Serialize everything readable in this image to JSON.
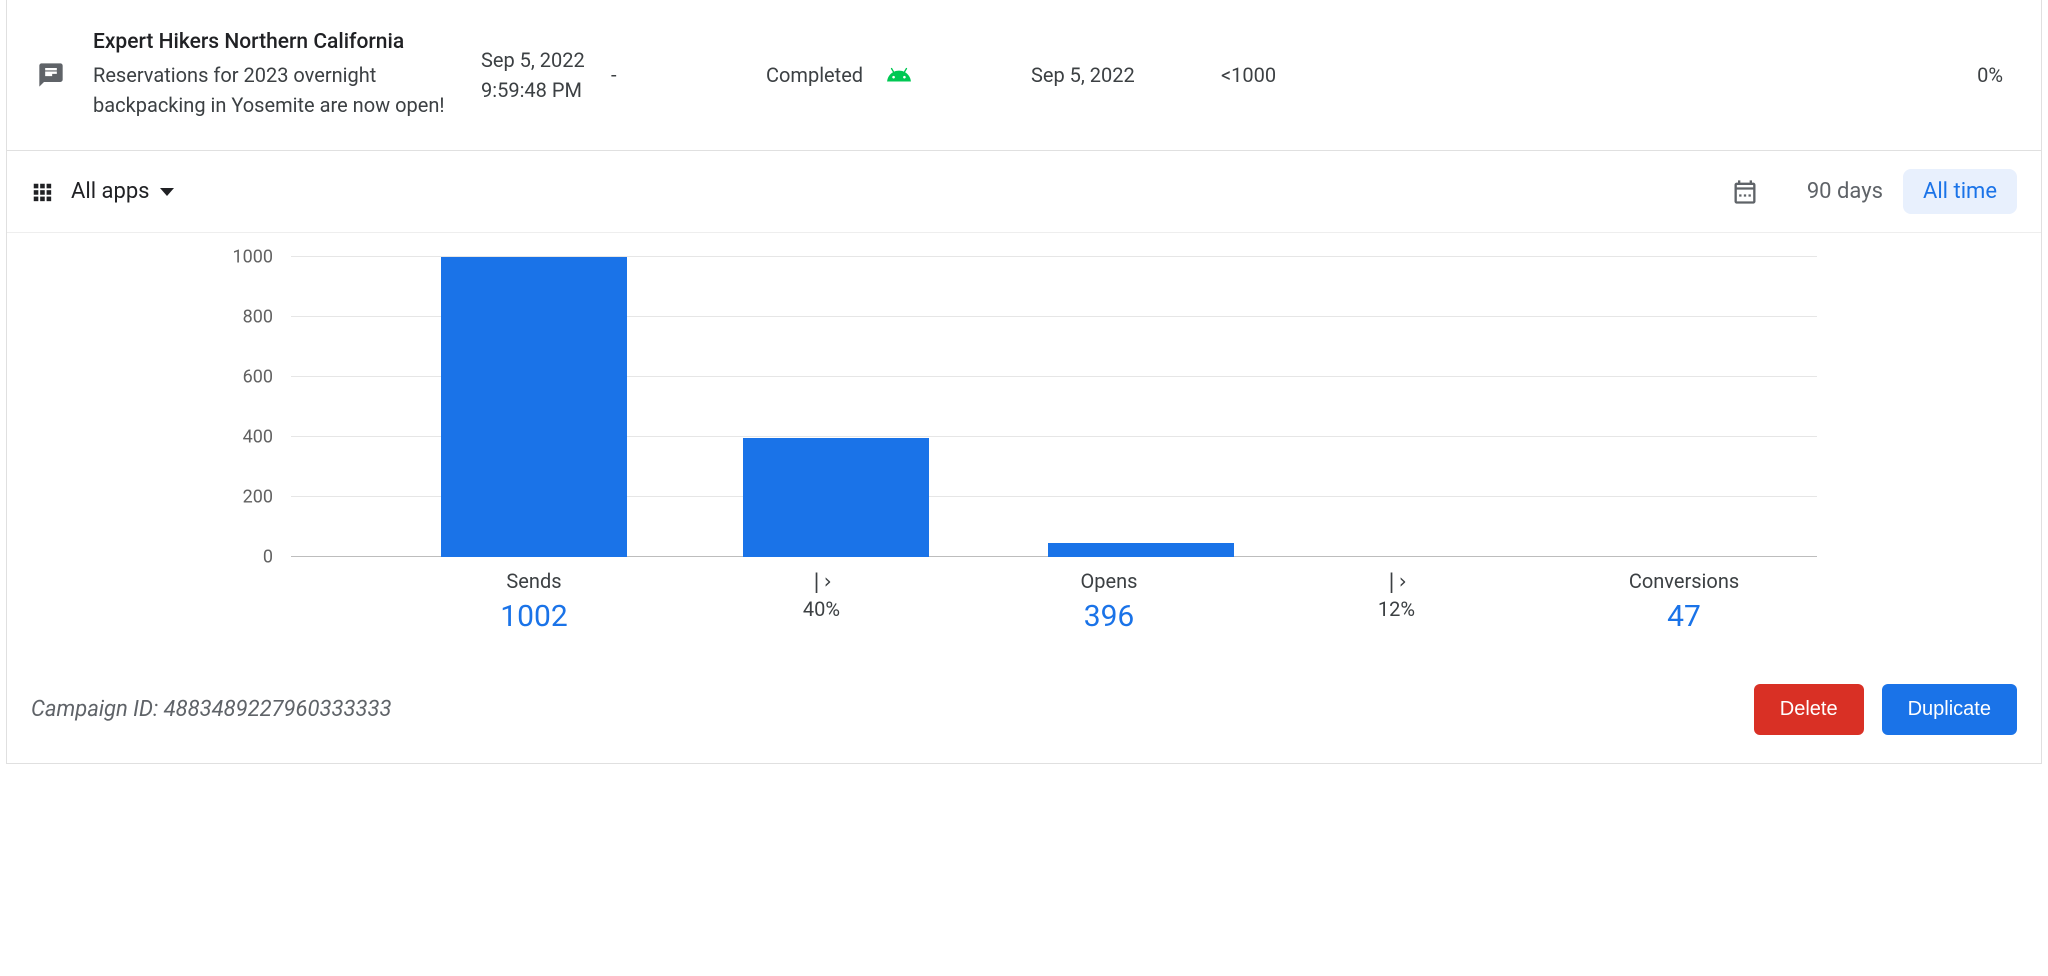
{
  "header": {
    "title": "Expert Hikers Northern California",
    "subtitle": "Reservations for 2023 overnight backpacking in Yosemite are now open!",
    "created_date": "Sep 5, 2022",
    "created_time": "9:59:48 PM",
    "dash": "-",
    "status": "Completed",
    "platform_icon": "android",
    "last_date": "Sep 5, 2022",
    "count": "<1000",
    "percent": "0%"
  },
  "filter": {
    "apps_label": "All apps",
    "range_90": "90 days",
    "range_all": "All time"
  },
  "chart_data": {
    "type": "bar",
    "categories": [
      "Sends",
      "Opens",
      "Conversions"
    ],
    "values": [
      1002,
      396,
      47
    ],
    "ylim": [
      0,
      1000
    ],
    "yticks": [
      0,
      200,
      400,
      600,
      800,
      1000
    ],
    "funnel_rates": [
      "40%",
      "12%"
    ]
  },
  "xaxis": {
    "g0_label": "Sends",
    "g0_value": "1002",
    "g1_label": "Opens",
    "g1_value": "396",
    "g2_label": "Conversions",
    "g2_value": "47",
    "rate0": "40%",
    "rate1": "12%"
  },
  "yticks": {
    "t0": "0",
    "t1": "200",
    "t2": "400",
    "t3": "600",
    "t4": "800",
    "t5": "1000"
  },
  "footer": {
    "campaign_id": "Campaign ID: 4883489227960333333",
    "delete": "Delete",
    "duplicate": "Duplicate"
  },
  "colors": {
    "primary": "#1a73e8",
    "danger": "#d93025",
    "android": "#00c853"
  }
}
